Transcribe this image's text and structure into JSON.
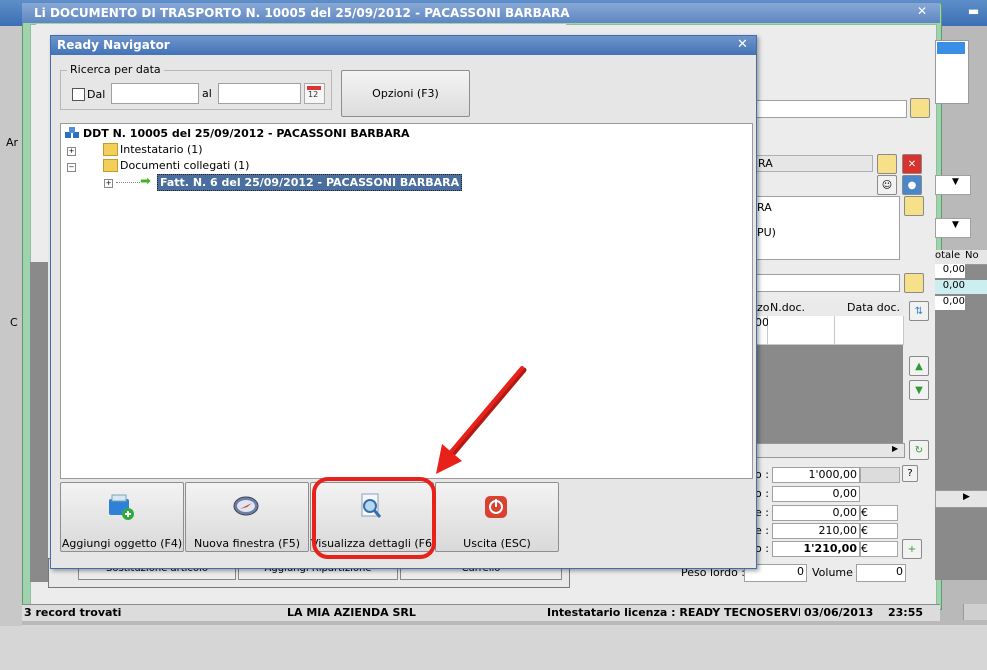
{
  "outer_window": {
    "min_button": "▬"
  },
  "doc_window": {
    "title": "Li DOCUMENTO DI TRASPORTO N. 10005 del 25/09/2012 - PACASSONI BARBARA",
    "close_glyph": "✕",
    "partial_labels": {
      "ar": "Ar",
      "c": "C"
    },
    "right_fields": {
      "name_fragment_1": "RA",
      "name_fragment_2": "RA",
      "name_fragment_3": "PU)"
    },
    "grid_headers": [
      "zo",
      "N.doc.",
      "Data doc."
    ],
    "grid_first_cell": "00",
    "side_grid": {
      "header_1": "otale",
      "header_2": "No",
      "values": [
        "0,00",
        "0,00",
        "0,00"
      ]
    },
    "totals": [
      {
        "suffix": "o :",
        "value": "1'000,00",
        "unit": ""
      },
      {
        "suffix": "o :",
        "value": "0,00",
        "unit": ""
      },
      {
        "suffix": "e :",
        "value": "0,00",
        "unit": "€"
      },
      {
        "suffix": "e :",
        "value": "210,00",
        "unit": "€"
      },
      {
        "suffix": "o :",
        "value": "1'210,00",
        "unit": "€"
      }
    ],
    "help_button": "?",
    "peso_lordo_label": "Peso lordo :",
    "peso_lordo_value": "0",
    "volume_label": "Volume :",
    "volume_value": "0",
    "bottom_buttons": [
      "Sostituzione articolo",
      "Aggiungi Ripartizione",
      "Carrello"
    ]
  },
  "statusbar": {
    "records": "3 record trovati",
    "company": "LA MIA AZIENDA SRL",
    "license": "Intestatario licenza : READY TECNOSERVICE S",
    "date": "03/06/2013",
    "time": "23:55"
  },
  "navigator": {
    "title": "Ready Navigator",
    "close_glyph": "✕",
    "search": {
      "legend": "Ricerca per data",
      "from_label": "Dal",
      "to_label": "al",
      "from_value": "",
      "to_value": "",
      "calendar_text": "12"
    },
    "options_button": "Opzioni (F3)",
    "tree": {
      "root": "DDT N. 10005 del 25/09/2012 - PACASSONI BARBARA",
      "children": [
        {
          "label": "Intestatario (1)",
          "expander": "+"
        },
        {
          "label": "Documenti collegati (1)",
          "expander": "−"
        }
      ],
      "linked_item": "Fatt. N. 6 del 25/09/2012 - PACASSONI BARBARA",
      "linked_expander": "+"
    },
    "toolbar": [
      {
        "label": "Aggiungi oggetto (F4)",
        "icon": "add-object-icon"
      },
      {
        "label": "Nuova finestra (F5)",
        "icon": "compass-icon"
      },
      {
        "label": "Visualizza dettagli (F6)",
        "icon": "magnifier-document-icon"
      },
      {
        "label": "Uscita (ESC)",
        "icon": "power-icon"
      }
    ]
  },
  "annotation": {
    "arrow_color": "#e8221b",
    "highlight_color": "#e8221b"
  }
}
